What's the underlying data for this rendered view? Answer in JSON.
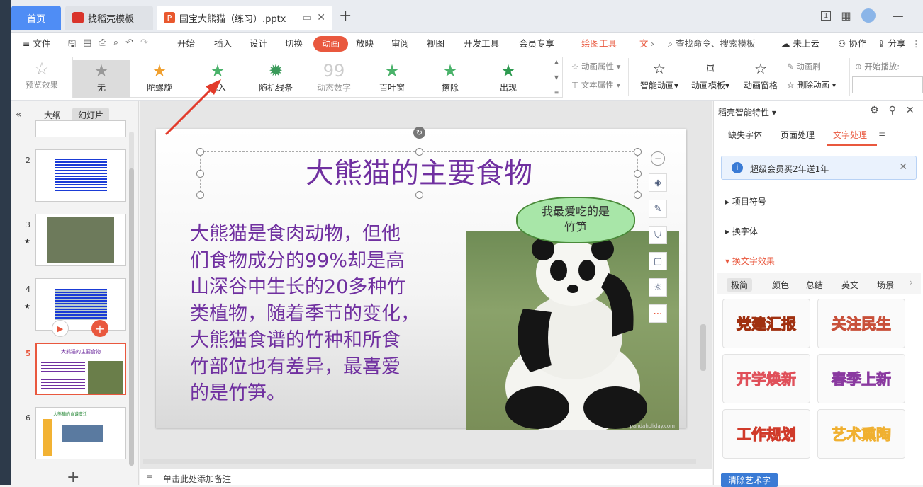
{
  "tabs": {
    "home": "首页",
    "docer": "找稻壳模板",
    "file": "国宝大熊猫（练习）.pptx",
    "add": "+"
  },
  "window": {
    "badge": "1"
  },
  "menu": {
    "file": "文件",
    "items": [
      "开始",
      "插入",
      "设计",
      "切换",
      "动画",
      "放映",
      "审阅",
      "视图",
      "开发工具",
      "会员专享"
    ],
    "drawing_tools": "绘图工具",
    "text_tool_short": "文",
    "search": "查找命令、搜索模板",
    "cloud": "未上云",
    "collab": "协作",
    "share": "分享"
  },
  "ribbon": {
    "preview": "预览效果",
    "effects": [
      "无",
      "陀螺旋",
      "飞入",
      "随机线条",
      "动态数字",
      "百叶窗",
      "擦除",
      "出现"
    ],
    "anim_props": "动画属性",
    "text_props": "文本属性",
    "smart_anim": "智能动画",
    "anim_template": "动画模板",
    "anim_pane": "动画窗格",
    "anim_brush": "动画刷",
    "delete_anim": "删除动画",
    "start_play": "开始播放:"
  },
  "leftpanel": {
    "outline": "大纲",
    "slides": "幻灯片",
    "slide_numbers": [
      "2",
      "3",
      "4",
      "5",
      "6"
    ],
    "thumb5_title": "大熊猫的主要食物",
    "thumb6_title": "大熊猫的食谱变迁",
    "add": "+"
  },
  "slide": {
    "title": "大熊猫的主要食物",
    "body": [
      "大熊猫是食肉动物，但他",
      "们食物成分的99%却是高",
      "山深谷中生长的20多种竹",
      "类植物，随着季节的变化，",
      "大熊猫食谱的竹种和所食",
      "竹部位也有差异，最喜爱",
      "的是竹笋。"
    ],
    "bubble": [
      "我最爱吃的是",
      "竹笋"
    ],
    "watermark": "pandaholiday.com"
  },
  "notes": {
    "placeholder": "单击此处添加备注"
  },
  "rightpanel": {
    "title": "稻壳智能特性",
    "tabs": [
      "缺失字体",
      "页面处理",
      "文字处理"
    ],
    "banner": "超级会员买2年送1年",
    "sections": [
      "项目符号",
      "换字体",
      "换文字效果"
    ],
    "subtabs": [
      "极简",
      "颜色",
      "总结",
      "英文",
      "场景"
    ],
    "arts": [
      "党建汇报",
      "关注民生",
      "开学焕新",
      "春季上新",
      "工作规划",
      "艺术熏陶"
    ],
    "clear": "清除艺术字"
  },
  "colors": {
    "accent": "#e9583e",
    "title": "#7030a0",
    "blue": "#4f8df5",
    "wps": "#e9582e"
  }
}
